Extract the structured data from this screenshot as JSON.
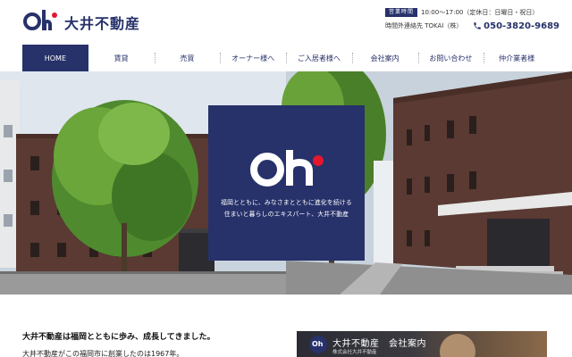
{
  "header": {
    "logo_text": "大井不動産",
    "hours_badge": "営業時間",
    "hours_text": "10:00～17:00（定休日：日曜日・祝日）",
    "tel_label": "時間外連絡先 TOKAI（株）",
    "tel_number": "050-3820-9689"
  },
  "nav": {
    "items": [
      {
        "label": "HOME",
        "active": true
      },
      {
        "label": "賃貸"
      },
      {
        "label": "売買"
      },
      {
        "label": "オーナー様へ"
      },
      {
        "label": "ご入居者様へ"
      },
      {
        "label": "会社案内"
      },
      {
        "label": "お問い合わせ"
      },
      {
        "label": "仲介業者様"
      }
    ]
  },
  "hero": {
    "tagline_line1": "福岡とともに、みなさまとともに進化を続ける",
    "tagline_line2": "住まいと暮らしのエキスパート、大井不動産"
  },
  "intro": {
    "heading": "大井不動産は福岡とともに歩み、成長してきました。",
    "body": "大井不動産がこの福岡市に創業したのは1967年。"
  },
  "company_banner": {
    "badge": "Oh",
    "title": "大井不動産　会社案内",
    "subtitle": "株式会社大井不動産"
  },
  "colors": {
    "brand_navy": "#27316a",
    "brand_red": "#e3172d"
  }
}
